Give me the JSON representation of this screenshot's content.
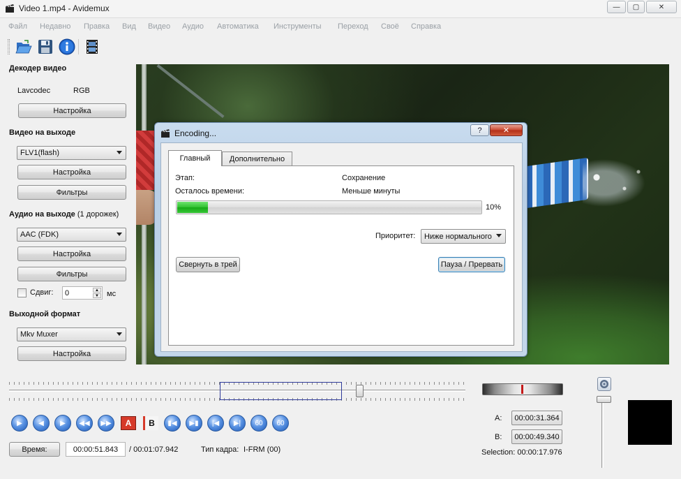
{
  "window": {
    "title": "Video 1.mp4 - Avidemux",
    "minimize": "—",
    "maximize": "▢",
    "close": "✕"
  },
  "menu": [
    "Файл",
    "Недавно",
    "Правка",
    "Вид",
    "Видео",
    "Аудио",
    "Автоматика",
    "Инструменты",
    "Переход",
    "Своё",
    "Справка"
  ],
  "toolbar": {
    "icons": [
      "open-icon",
      "save-icon",
      "info-icon",
      "film-icon"
    ],
    "info_glyph": "i"
  },
  "left": {
    "decoder_title": "Декодер видео",
    "decoder_name": "Lavcodec",
    "decoder_format": "RGB",
    "decoder_config": "Настройка",
    "video_out_title": "Видео на выходе",
    "video_codec": "FLV1(flash)",
    "video_config": "Настройка",
    "video_filters": "Фильтры",
    "audio_out_title": "Аудио на выходе",
    "audio_tracks": "(1 дорожек)",
    "audio_codec": "AAC (FDK)",
    "audio_config": "Настройка",
    "audio_filters": "Фильтры",
    "shift_label": "Сдвиг:",
    "shift_value": "0",
    "shift_unit": "мс",
    "format_title": "Выходной формат",
    "muxer": "Mkv Muxer",
    "muxer_config": "Настройка"
  },
  "dialog": {
    "title": "Encoding...",
    "help": "?",
    "close": "✕",
    "tab_main": "Главный",
    "tab_advanced": "Дополнительно",
    "phase_label": "Этап:",
    "phase_value": "Сохранение",
    "remaining_label": "Осталось времени:",
    "remaining_value": "Меньше минуты",
    "progress": 10,
    "progress_text": "10%",
    "priority_label": "Приоритет:",
    "priority_value": "Ниже нормального",
    "tray_button": "Свернуть в трей",
    "pause_button": "Пауза / Прервать"
  },
  "navigation": {
    "marker_a": "A",
    "marker_b": "B",
    "slider_position": 0.76
  },
  "status": {
    "time_button": "Время:",
    "current_time": "00:00:51.843",
    "duration": "/ 00:01:07.942",
    "frame_type_label": "Тип кадра:",
    "frame_type": "I-FRM (00)",
    "a_label": "A:",
    "a_time": "00:00:31.364",
    "b_label": "B:",
    "b_time": "00:00:49.340",
    "selection": "Selection: 00:00:17.976"
  },
  "colors": {
    "accent_blue": "#1d58b5",
    "progress_green": "#2fc02f",
    "marker_red": "#c41a1a"
  }
}
